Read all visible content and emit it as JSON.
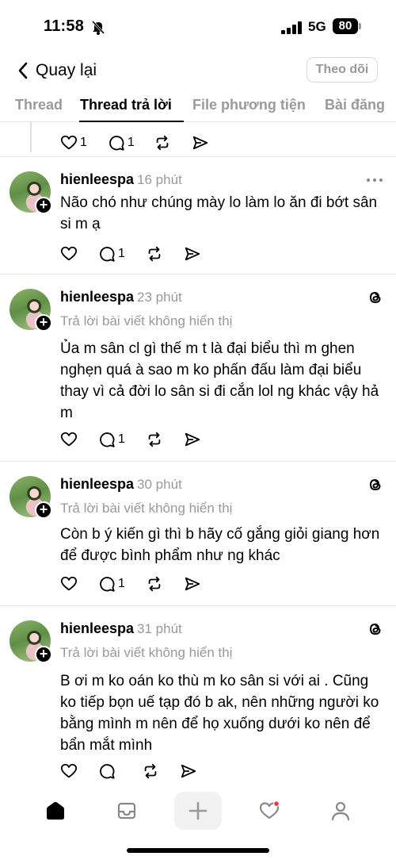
{
  "status_bar": {
    "time": "11:58",
    "network": "5G",
    "battery": "80"
  },
  "nav": {
    "back_label": "Quay lại",
    "follow_label": "Theo dõi"
  },
  "tabs": [
    {
      "label": "Thread"
    },
    {
      "label": "Thread trả lời"
    },
    {
      "label": "File phương tiện"
    },
    {
      "label": "Bài đăng"
    }
  ],
  "prev_actions": {
    "likes": "1",
    "comments": "1"
  },
  "posts": [
    {
      "username": "hienleespa",
      "time": "16 phút",
      "text": "Não chó như chúng mày lo làm lo ăn đi bớt sân si m ạ",
      "likes": "",
      "comments": "1"
    },
    {
      "username": "hienleespa",
      "time": "23 phút",
      "reply_note": "Trả lời bài viết không hiển thị",
      "text": "Ủa m sân cl gì thế m t là đại biểu thì m ghen nghẹn quá à sao m ko phấn đấu làm đại biểu thay vì cả đời lo sân si đi cắn lol ng khác vậy hả m",
      "likes": "",
      "comments": "1"
    },
    {
      "username": "hienleespa",
      "time": "30 phút",
      "reply_note": "Trả lời bài viết không hiển thị",
      "text": "Còn b ý kiến gì thì b hãy cố gắng giỏi giang hơn để được bình phẩm như ng khác",
      "likes": "",
      "comments": "1"
    },
    {
      "username": "hienleespa",
      "time": "31 phút",
      "reply_note": "Trả lời bài viết không hiển thị",
      "text": "B ơi m ko oán ko thù m ko sân si với ai . Cũng ko tiếp bọn uế tạp đó b ak, nên những người ko bằng mình m nên để họ xuống dưới ko nên để bẩn mắt mình",
      "likes": "",
      "comments": ""
    }
  ],
  "colors": {
    "notification_dot": "#ff3040",
    "muted": "#999999"
  },
  "icons": [
    "heart-icon",
    "comment-icon",
    "repost-icon",
    "share-icon",
    "home-icon",
    "inbox-icon",
    "plus-icon",
    "activity-icon",
    "profile-icon",
    "threads-icon",
    "more-icon"
  ]
}
